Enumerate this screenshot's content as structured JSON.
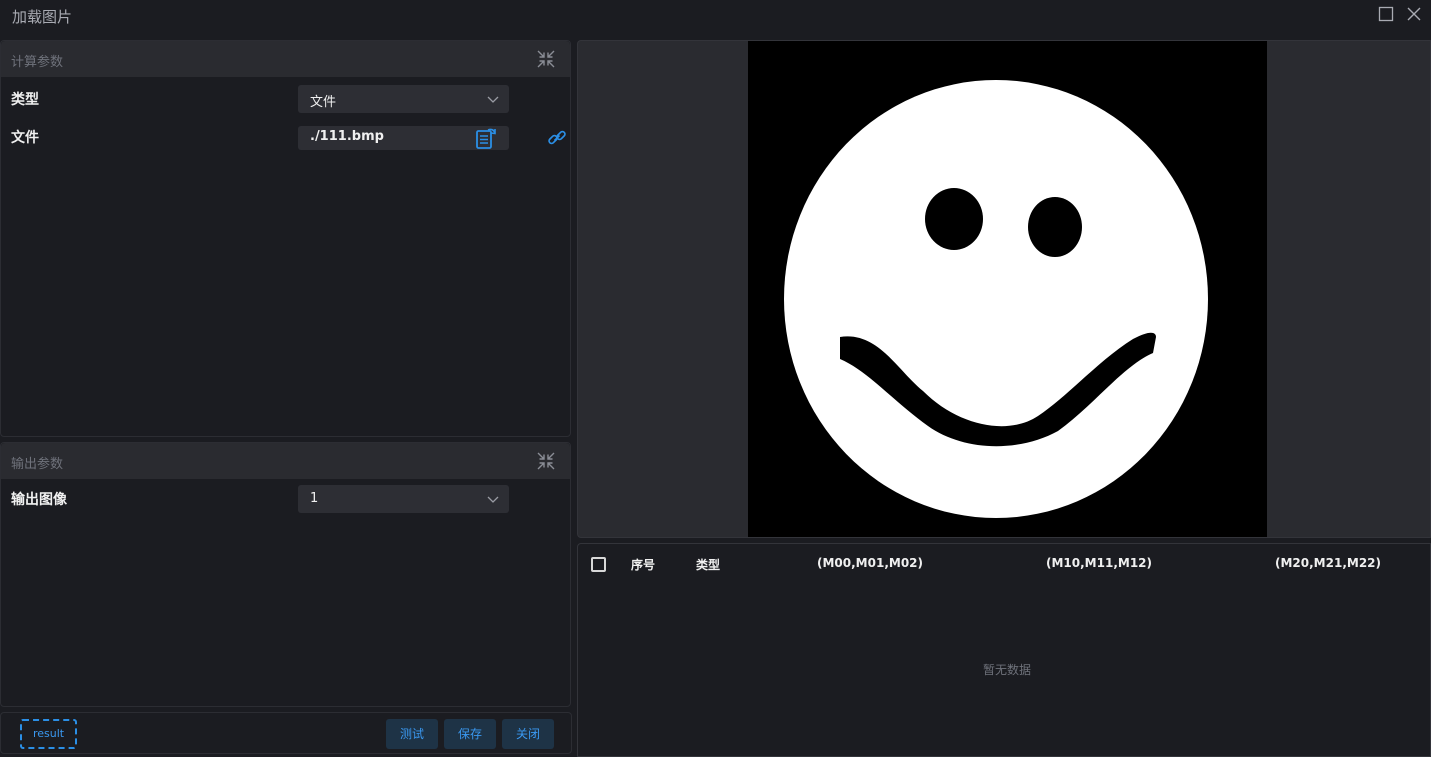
{
  "window": {
    "title": "加载图片",
    "maximize_icon": "maximize-icon",
    "close_icon": "close-icon"
  },
  "calc_section": {
    "title": "计算参数",
    "type_label": "类型",
    "type_value": "文件",
    "file_label": "文件",
    "file_value": "./111.bmp"
  },
  "output_section": {
    "title": "输出参数",
    "image_label": "输出图像",
    "image_value": "1"
  },
  "footer": {
    "result_label": "result",
    "test_label": "测试",
    "save_label": "保存",
    "close_label": "关闭"
  },
  "table": {
    "columns": [
      "序号",
      "类型",
      "(M00,M01,M02)",
      "(M10,M11,M12)",
      "(M20,M21,M22)"
    ],
    "empty_text": "暂无数据",
    "rows": []
  },
  "colors": {
    "accent": "#2b8fe6",
    "panel_bg": "#1b1c21",
    "header_bg": "#2a2b30"
  }
}
